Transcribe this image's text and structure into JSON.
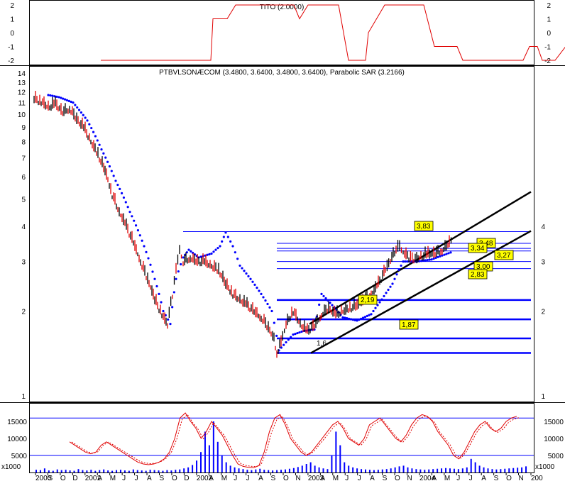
{
  "colors": {
    "frame": "#000000",
    "price_up": "#000000",
    "price_down": "#e00000",
    "sar": "#0000ff",
    "support": "#0000ff",
    "channel": "#000000",
    "tito": "#e00000",
    "volume": "#0000ff",
    "osc_line": "#e00000",
    "annotation_bg": "#ffff00"
  },
  "chart_data": [
    {
      "type": "line",
      "title": "TITO (2.0000)",
      "ylim": [
        -2,
        2
      ],
      "yticks": [
        "2",
        "1",
        "0",
        "-1",
        "-2"
      ],
      "x": [
        0,
        90,
        155,
        158,
        162,
        178,
        190,
        195,
        205,
        272,
        280,
        292,
        335,
        349,
        373,
        377,
        400,
        455,
        470,
        502,
        510,
        595,
        604,
        615,
        622,
        640,
        655,
        660,
        675,
        676
      ],
      "values": [
        -2,
        -2,
        -2,
        1,
        1,
        1,
        2,
        2,
        2,
        2,
        1,
        2,
        2,
        -2,
        -2,
        0,
        2,
        2,
        -1,
        -1,
        -2,
        -2,
        -1,
        -1,
        -2,
        -2,
        -1,
        -1,
        2,
        2
      ]
    },
    {
      "type": "line",
      "title": "PTBVLSONÆCOM (3.4800, 3.6400, 3.4800, 3.6400), Parabolic SAR (3.2166)",
      "scale": "log",
      "ylim": [
        0.9,
        14
      ],
      "yticks": [
        "14",
        "13",
        "12",
        "11",
        "10",
        "9",
        "8",
        "7",
        "6",
        "5",
        "4",
        "3",
        "2",
        "1"
      ],
      "xticks": [
        "2000",
        "S",
        "O",
        "D",
        "2001",
        "A",
        "M",
        "J",
        "J",
        "A",
        "S",
        "O",
        "D",
        "2002",
        "A",
        "M",
        "J",
        "J",
        "A",
        "S",
        "O",
        "N",
        "2003",
        "A",
        "M",
        "J",
        "J",
        "A",
        "S",
        "O",
        "N",
        "2004",
        "A",
        "M",
        "J",
        "J",
        "A",
        "S",
        "O",
        "N",
        "200"
      ],
      "annotations": [
        "3,83",
        "3,48",
        "3,34",
        "3,27",
        "3,00",
        "2,83",
        "2,19",
        "1,87",
        "1,6"
      ],
      "price_points": [
        [
          0,
          11.4
        ],
        [
          10,
          11.1
        ],
        [
          20,
          10.6
        ],
        [
          30,
          10.9
        ],
        [
          40,
          10.2
        ],
        [
          50,
          10.5
        ],
        [
          60,
          9.6
        ],
        [
          70,
          9.0
        ],
        [
          80,
          8.0
        ],
        [
          90,
          7.2
        ],
        [
          100,
          6.3
        ],
        [
          110,
          5.2
        ],
        [
          120,
          4.5
        ],
        [
          130,
          4.0
        ],
        [
          140,
          3.5
        ],
        [
          150,
          3.0
        ],
        [
          160,
          2.6
        ],
        [
          170,
          2.2
        ],
        [
          180,
          1.95
        ],
        [
          188,
          1.8
        ],
        [
          195,
          2.3
        ],
        [
          200,
          2.8
        ],
        [
          205,
          3.3
        ],
        [
          210,
          3.0
        ],
        [
          220,
          3.1
        ],
        [
          230,
          3.0
        ],
        [
          240,
          3.0
        ],
        [
          250,
          2.9
        ],
        [
          260,
          2.8
        ],
        [
          270,
          2.5
        ],
        [
          280,
          2.3
        ],
        [
          290,
          2.2
        ],
        [
          300,
          2.1
        ],
        [
          310,
          2.0
        ],
        [
          320,
          1.9
        ],
        [
          330,
          1.75
        ],
        [
          338,
          1.6
        ],
        [
          342,
          1.42
        ],
        [
          348,
          1.55
        ],
        [
          355,
          1.8
        ],
        [
          365,
          2.0
        ],
        [
          375,
          1.8
        ],
        [
          385,
          1.7
        ],
        [
          395,
          1.78
        ],
        [
          405,
          1.95
        ],
        [
          415,
          2.05
        ],
        [
          425,
          1.95
        ],
        [
          435,
          2.0
        ],
        [
          445,
          2.05
        ],
        [
          455,
          2.1
        ],
        [
          465,
          2.2
        ],
        [
          475,
          2.3
        ],
        [
          485,
          2.5
        ],
        [
          495,
          2.8
        ],
        [
          502,
          3.05
        ],
        [
          510,
          3.3
        ],
        [
          515,
          3.4
        ],
        [
          520,
          3.25
        ],
        [
          528,
          3.1
        ],
        [
          535,
          3.05
        ],
        [
          545,
          3.12
        ],
        [
          555,
          3.2
        ],
        [
          565,
          3.22
        ],
        [
          575,
          3.3
        ],
        [
          585,
          3.5
        ],
        [
          590,
          3.6
        ]
      ],
      "sar_points": [
        [
          20,
          11.7
        ],
        [
          35,
          11.5
        ],
        [
          55,
          11.0
        ],
        [
          75,
          9.5
        ],
        [
          95,
          7.5
        ],
        [
          115,
          5.8
        ],
        [
          135,
          4.5
        ],
        [
          155,
          3.4
        ],
        [
          170,
          2.6
        ],
        [
          182,
          2.0
        ],
        [
          192,
          1.8
        ],
        [
          200,
          2.6
        ],
        [
          210,
          3.1
        ],
        [
          218,
          3.3
        ],
        [
          232,
          3.1
        ],
        [
          250,
          3.2
        ],
        [
          262,
          3.4
        ],
        [
          270,
          3.8
        ],
        [
          280,
          3.4
        ],
        [
          290,
          2.9
        ],
        [
          305,
          2.6
        ],
        [
          320,
          2.3
        ],
        [
          335,
          2.0
        ],
        [
          345,
          1.45
        ],
        [
          355,
          1.55
        ],
        [
          365,
          1.65
        ],
        [
          380,
          1.7
        ],
        [
          395,
          1.72
        ],
        [
          405,
          2.3
        ],
        [
          420,
          2.1
        ],
        [
          435,
          1.9
        ],
        [
          455,
          1.85
        ],
        [
          475,
          1.95
        ],
        [
          490,
          2.2
        ],
        [
          505,
          2.5
        ],
        [
          520,
          3.0
        ],
        [
          540,
          3.0
        ],
        [
          560,
          3.05
        ],
        [
          575,
          3.15
        ],
        [
          590,
          3.25
        ]
      ],
      "channel_lines": [
        [
          [
            340,
            1.42
          ],
          [
            700,
            3.85
          ]
        ],
        [
          [
            338,
            1.8
          ],
          [
            700,
            5.3
          ]
        ]
      ],
      "support_levels": [
        3.83,
        3.48,
        3.34,
        3.27,
        3.0,
        2.83,
        2.19,
        1.87,
        1.6,
        1.42
      ]
    },
    {
      "type": "bar",
      "scale_label": "x1000",
      "ylim": [
        0,
        20000
      ],
      "yticks": [
        "15000",
        "10000",
        "5000"
      ],
      "hlines": [
        16000,
        5000
      ],
      "volume": [
        800,
        700,
        1200,
        600,
        500,
        900,
        700,
        800,
        600,
        500,
        1000,
        700,
        600,
        800,
        500,
        700,
        900,
        600,
        500,
        700,
        800,
        600,
        500,
        900,
        700,
        600,
        500,
        800,
        700,
        600,
        500,
        700,
        600,
        800,
        900,
        1200,
        1500,
        2200,
        3500,
        6000,
        12000,
        8000,
        15000,
        9000,
        5000,
        3000,
        2000,
        1500,
        1200,
        1000,
        800,
        700,
        900,
        1100,
        800,
        700,
        600,
        700,
        800,
        900,
        1100,
        1300,
        1600,
        2000,
        2500,
        3000,
        2000,
        1500,
        1200,
        1000,
        5000,
        12000,
        8000,
        3000,
        2000,
        1500,
        1200,
        1000,
        900,
        800,
        700,
        800,
        900,
        1000,
        1200,
        1500,
        1800,
        2000,
        1500,
        1200,
        1000,
        900,
        800,
        900,
        1000,
        1100,
        1200,
        1300,
        1200,
        1100,
        1000,
        1200,
        1500,
        4000,
        3000,
        2000,
        1500,
        1200,
        1000,
        900,
        1000,
        1100,
        1200,
        1300,
        1400,
        1500,
        1800
      ],
      "oscillator": [
        9000,
        8000,
        7000,
        6000,
        5500,
        6000,
        8000,
        9000,
        8000,
        7000,
        6000,
        5000,
        4000,
        3000,
        2500,
        2300,
        2500,
        3000,
        4000,
        6000,
        10000,
        16000,
        17500,
        15000,
        13000,
        10000,
        12000,
        15000,
        13000,
        11000,
        8000,
        5000,
        2500,
        1800,
        1500,
        1400,
        2000,
        6000,
        12000,
        16000,
        17000,
        14000,
        10000,
        8000,
        6000,
        5000,
        6000,
        8000,
        10000,
        12000,
        14000,
        15000,
        13000,
        10000,
        9000,
        8000,
        10000,
        14000,
        15000,
        16000,
        14000,
        12000,
        10000,
        9000,
        11000,
        14000,
        16000,
        17000,
        16500,
        15000,
        12000,
        10000,
        8000,
        5000,
        4000,
        6000,
        9000,
        12000,
        14000,
        15000,
        13000,
        12000,
        13000,
        15000,
        16000,
        16500
      ]
    }
  ],
  "mid_labels": {
    "right_3": "3",
    "right_2": "2",
    "right_4": "4"
  }
}
